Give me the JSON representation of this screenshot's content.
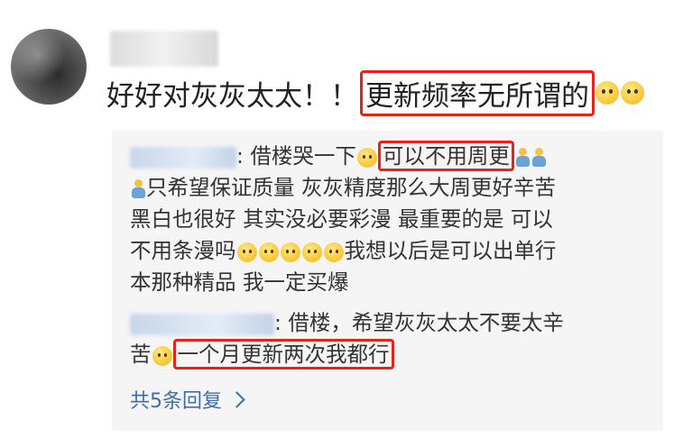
{
  "comment": {
    "text_before": "好好对灰灰太太！！",
    "highlight": "更新频率无所谓的"
  },
  "replies": [
    {
      "line1_before": ": 借楼哭一下",
      "line1_highlight": "可以不用周更",
      "line2_after": "只希望保证质量 灰灰精度那么大周更好辛苦",
      "line3": "黑白也很好 其实没必要彩漫 最重要的是 可以",
      "line4_before": "不用条漫吗",
      "line4_after": "我想以后是可以出单行",
      "line5": "本那种精品 我一定买爆"
    },
    {
      "line1": ": 借楼，希望灰灰太太不要太辛",
      "line2_before": "苦",
      "line2_highlight": "一个月更新两次我都行"
    }
  ],
  "more_replies": "共5条回复",
  "icons": [
    "pleading-face-icon",
    "crying-face-icon",
    "person-icon",
    "sleepy-face-icon",
    "loudly-crying-face-icon",
    "chevron-right-icon"
  ],
  "colors": {
    "highlight_border": "#e8211b",
    "link": "#3f6ea8",
    "reply_bg": "#f5f5f5"
  }
}
